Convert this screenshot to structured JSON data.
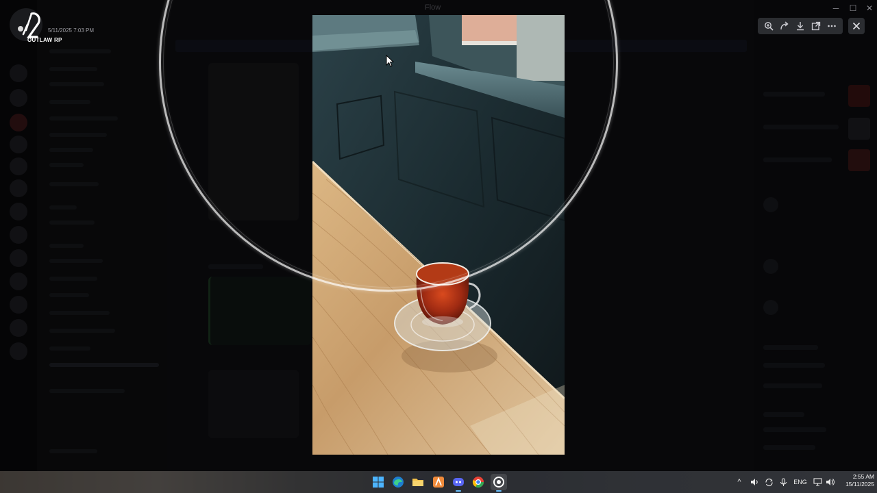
{
  "window": {
    "title": "Flow",
    "min_glyph": "─",
    "max_glyph": "☐",
    "close_glyph": "✕"
  },
  "server_logo": {
    "brand_text": "OUTLAW RP",
    "timestamp": "5/11/2025 7:03 PM"
  },
  "image_viewer": {
    "toolbar": [
      {
        "name": "zoom-icon",
        "glyph": "⊕"
      },
      {
        "name": "forward-icon",
        "glyph": "↪"
      },
      {
        "name": "download-icon",
        "glyph": "⤓"
      },
      {
        "name": "open-external-icon",
        "glyph": "⧉"
      },
      {
        "name": "more-icon",
        "glyph": "⋯"
      }
    ],
    "close_glyph": "✕",
    "photo_subject": "glass-tea-cup-on-wooden-counter"
  },
  "taskbar": {
    "apps": [
      {
        "name": "windows-start-icon",
        "color": "#3aa0f0"
      },
      {
        "name": "edge-icon",
        "color": "#2fa6e8"
      },
      {
        "name": "file-explorer-icon",
        "color": "#f4c24b"
      },
      {
        "name": "app-a-icon",
        "color": "#f08a3a"
      },
      {
        "name": "discord-icon",
        "color": "#5865f2"
      },
      {
        "name": "chrome-icon",
        "color": "#e94235"
      },
      {
        "name": "app-active-icon",
        "color": "#d94a5a"
      }
    ],
    "tray": {
      "chevron": "^",
      "language": "ENG",
      "time": "2:55 AM",
      "date": "15/11/2025"
    }
  },
  "colors": {
    "viewer_toolbar_bg": "#2b2d31",
    "wood": "#c79c6a",
    "tea": "#9e2a12",
    "wall": "#1d2c30"
  }
}
